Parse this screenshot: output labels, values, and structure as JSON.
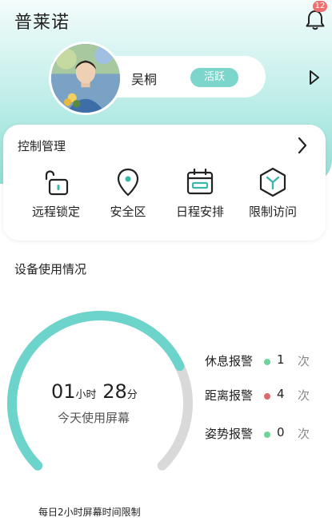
{
  "header": {
    "app_title": "普莱诺",
    "notification_count": "12"
  },
  "profile": {
    "name": "吴桐",
    "status": "活跃"
  },
  "control": {
    "title": "控制管理",
    "items": [
      {
        "label": "远程锁定",
        "icon": "unlock-icon"
      },
      {
        "label": "安全区",
        "icon": "location-pin-icon"
      },
      {
        "label": "日程安排",
        "icon": "calendar-icon"
      },
      {
        "label": "限制访问",
        "icon": "restrict-icon"
      }
    ]
  },
  "usage": {
    "section_title": "设备使用情况",
    "hours": "01",
    "hours_unit": "小时",
    "minutes": "28",
    "minutes_unit": "分",
    "label": "今天使用屏幕",
    "daily_limit_text": "每日2小时屏幕时间限制",
    "progress_fraction": 0.74
  },
  "alerts": [
    {
      "name": "休息报警",
      "value": "1",
      "unit": "次",
      "color": "#6fd39a"
    },
    {
      "name": "距离报警",
      "value": "4",
      "unit": "次",
      "color": "#e06a6a"
    },
    {
      "name": "姿势报警",
      "value": "0",
      "unit": "次",
      "color": "#6fd39a"
    }
  ],
  "colors": {
    "accent": "#7cd6cb",
    "gauge_track": "#d9d9d9",
    "gauge_fill": "#6dd4cc"
  }
}
